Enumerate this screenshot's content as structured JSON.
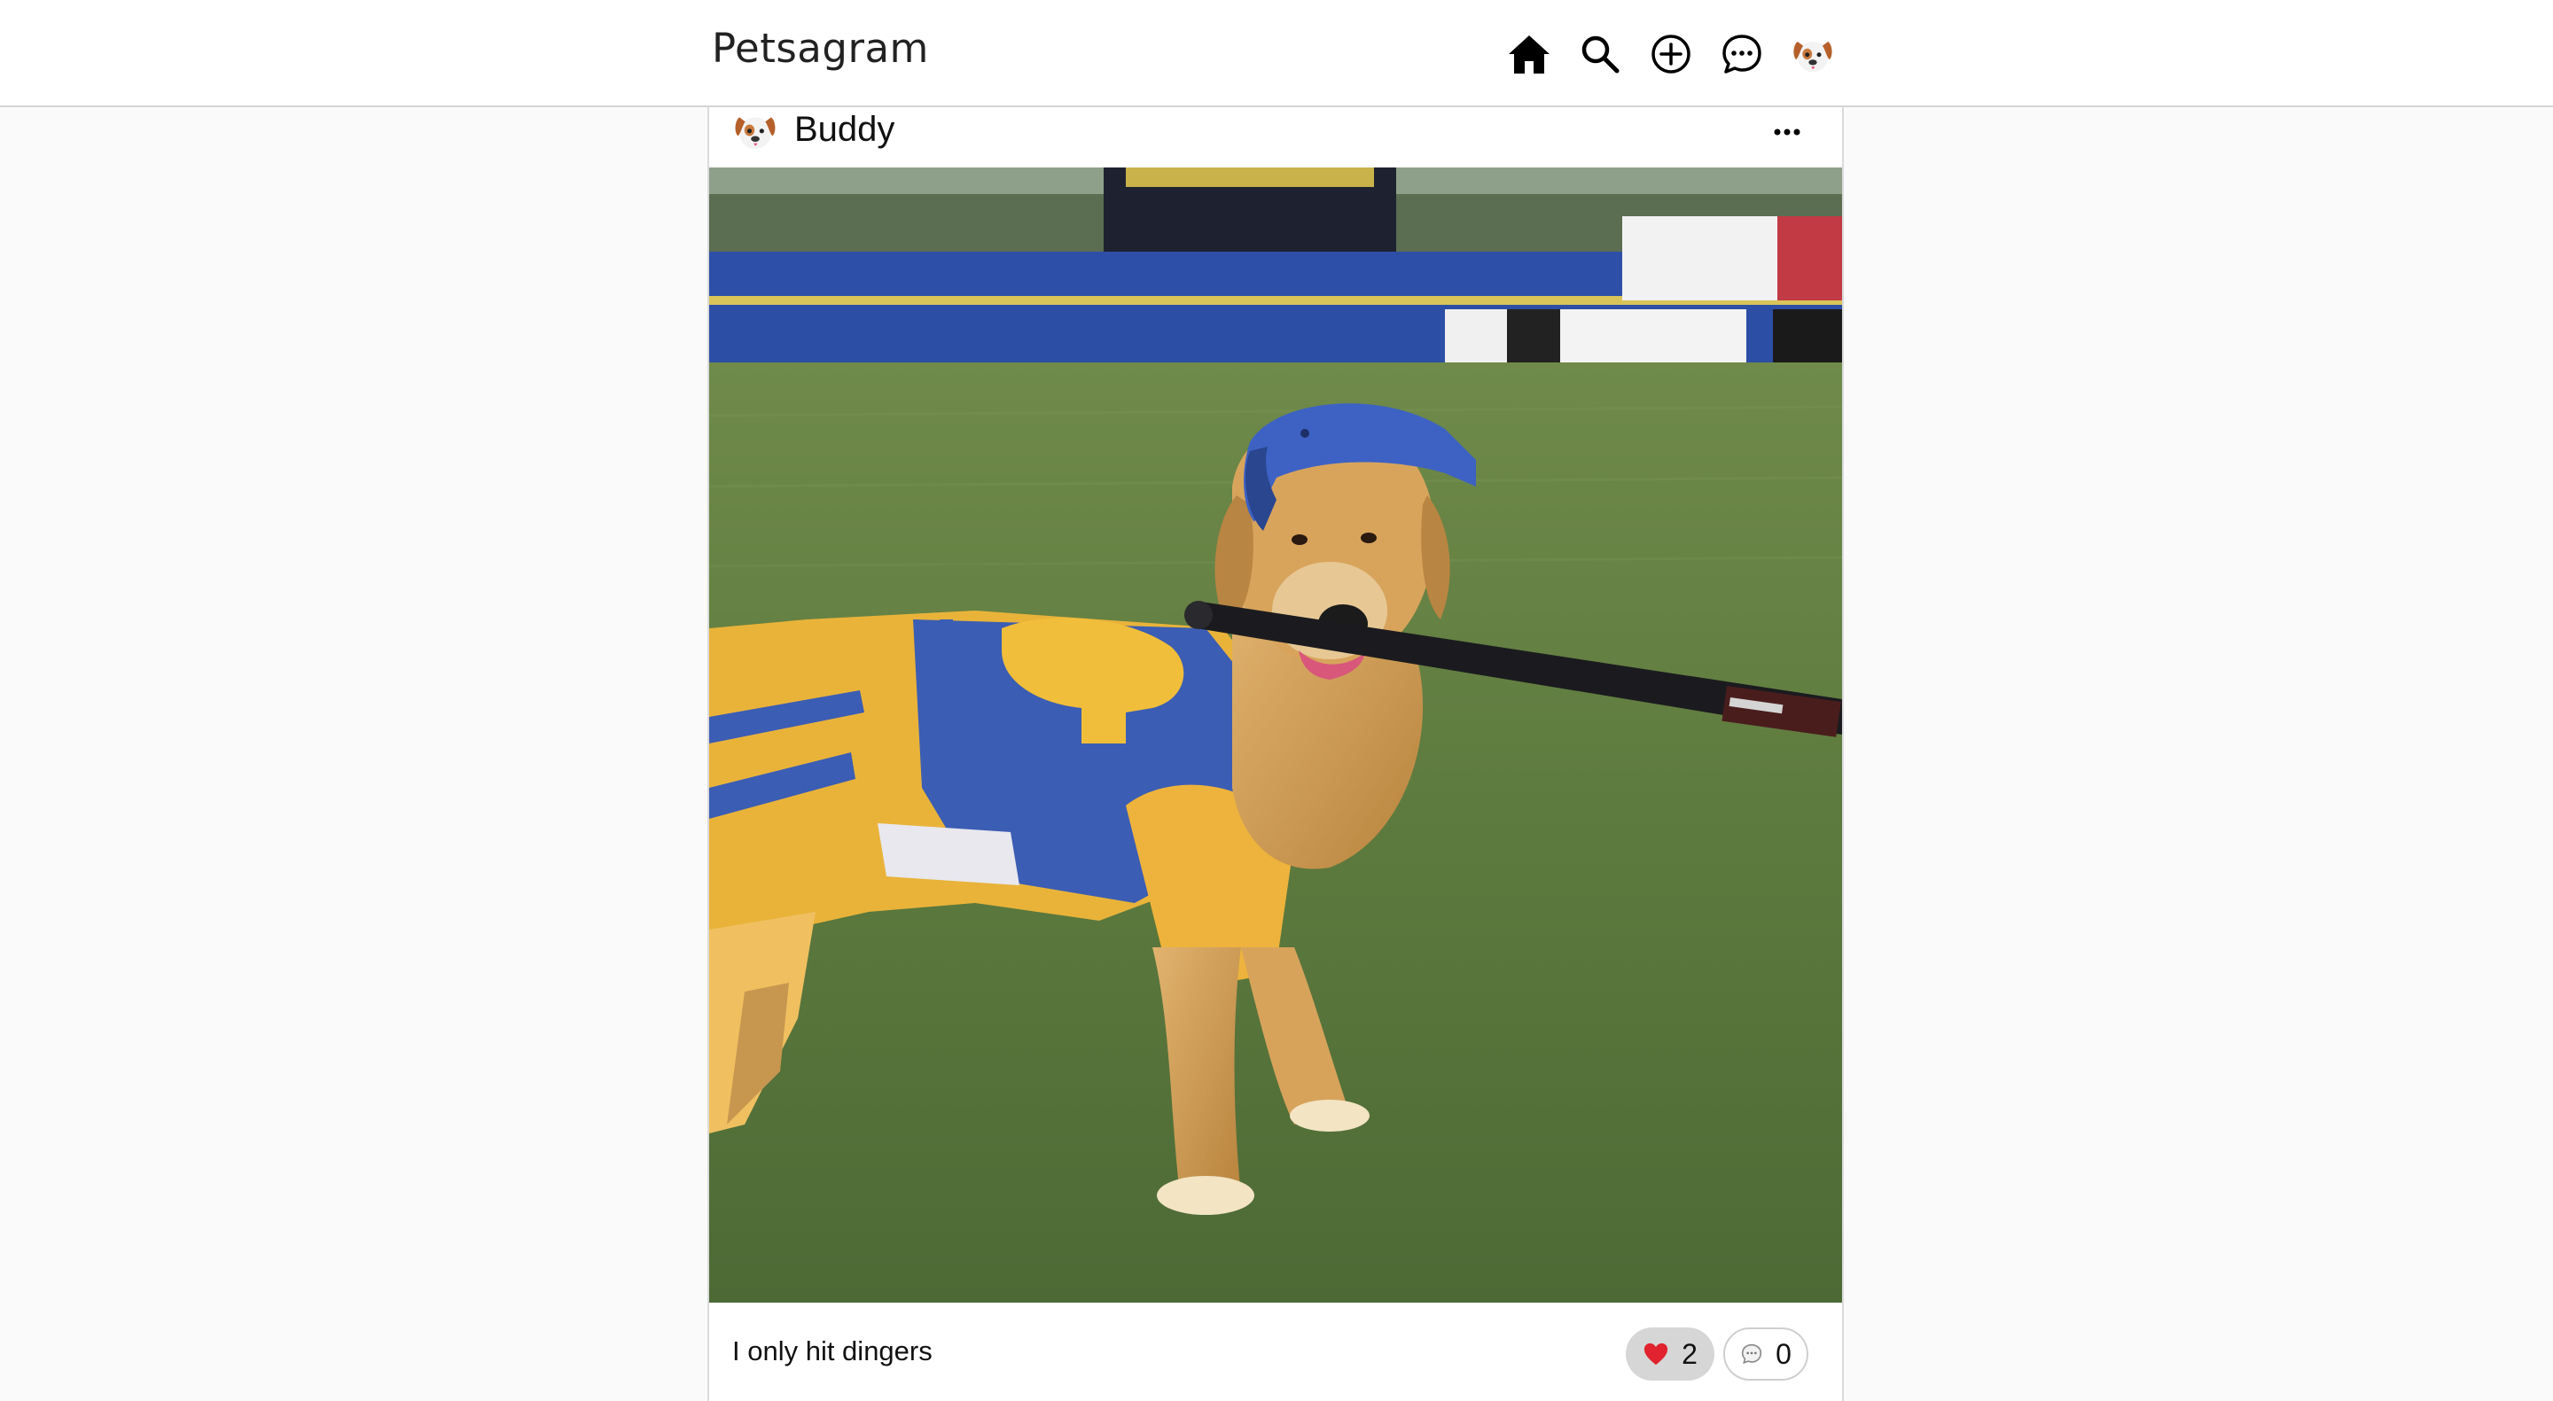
{
  "app": {
    "brand": "Petsagram"
  },
  "nav": {
    "icons": [
      "home-icon",
      "search-icon",
      "add-post-icon",
      "messages-icon",
      "profile-avatar"
    ]
  },
  "post": {
    "username": "Buddy",
    "avatar_icon": "dog-face-icon",
    "menu_icon": "more-options-icon",
    "photo_description": "golden-retriever-baseball-photo",
    "caption": "I only hit dingers",
    "likes": {
      "icon": "heart-icon",
      "count": "2"
    },
    "comments": {
      "icon": "comment-bubble-icon",
      "count": "0"
    }
  },
  "colors": {
    "accent_like_bg": "#d6d6d6",
    "heart": "#e0232e",
    "text": "#111111",
    "page_bg": "#fafafa"
  }
}
